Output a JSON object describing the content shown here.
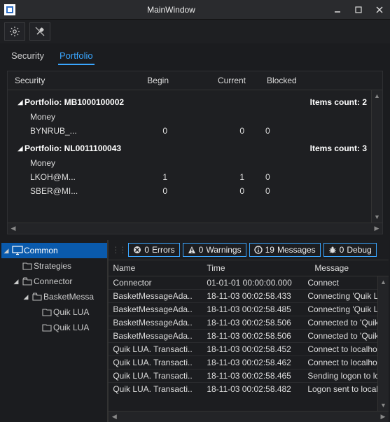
{
  "window": {
    "title": "MainWindow"
  },
  "tabs": {
    "security": "Security",
    "portfolio": "Portfolio",
    "active": "portfolio"
  },
  "grid": {
    "headers": {
      "security": "Security",
      "begin": "Begin",
      "current": "Current",
      "blocked": "Blocked"
    },
    "portfolio_label": "Portfolio:",
    "items_count_label": "Items count:",
    "groups": [
      {
        "id": "MB1000100002",
        "count": 2,
        "rows": [
          {
            "sec": "Money",
            "begin": "",
            "current": "",
            "blocked": ""
          },
          {
            "sec": "BYNRUB_...",
            "begin": "0",
            "current": "0",
            "blocked": "0"
          }
        ]
      },
      {
        "id": "NL0011100043",
        "count": 3,
        "rows": [
          {
            "sec": "Money",
            "begin": "",
            "current": "",
            "blocked": ""
          },
          {
            "sec": "LKOH@M...",
            "begin": "1",
            "current": "1",
            "blocked": "0"
          },
          {
            "sec": "SBER@MI...",
            "begin": "0",
            "current": "0",
            "blocked": "0"
          }
        ]
      }
    ]
  },
  "tree": {
    "items": [
      {
        "label": "Common",
        "icon": "monitor",
        "indent": 0,
        "expandable": true,
        "selected": true
      },
      {
        "label": "Strategies",
        "icon": "folder",
        "indent": 1,
        "expandable": false
      },
      {
        "label": "Connector",
        "icon": "folder-open",
        "indent": 1,
        "expandable": true
      },
      {
        "label": "BasketMessa",
        "icon": "folder-open",
        "indent": 2,
        "expandable": true
      },
      {
        "label": "Quik LUA",
        "icon": "folder",
        "indent": 3,
        "expandable": false
      },
      {
        "label": "Quik LUA",
        "icon": "folder",
        "indent": 3,
        "expandable": false
      }
    ]
  },
  "filters": {
    "errors": {
      "count": 0,
      "label": "Errors"
    },
    "warnings": {
      "count": 0,
      "label": "Warnings"
    },
    "messages": {
      "count": 19,
      "label": "Messages"
    },
    "debug": {
      "count": 0,
      "label": "Debug"
    }
  },
  "log": {
    "headers": {
      "name": "Name",
      "time": "Time",
      "message": "Message"
    },
    "rows": [
      {
        "name": "Connector",
        "time": "01-01-01 00:00:00.000",
        "msg": "Connect"
      },
      {
        "name": "BasketMessageAda..",
        "time": "18-11-03 00:02:58.433",
        "msg": "Connecting 'Quik LU"
      },
      {
        "name": "BasketMessageAda..",
        "time": "18-11-03 00:02:58.485",
        "msg": "Connecting 'Quik LU"
      },
      {
        "name": "BasketMessageAda..",
        "time": "18-11-03 00:02:58.506",
        "msg": "Connected to 'Quik l"
      },
      {
        "name": "BasketMessageAda..",
        "time": "18-11-03 00:02:58.506",
        "msg": "Connected to 'Quik l"
      },
      {
        "name": "Quik LUA. Transacti..",
        "time": "18-11-03 00:02:58.452",
        "msg": "Connect to localhost"
      },
      {
        "name": "Quik LUA. Transacti..",
        "time": "18-11-03 00:02:58.462",
        "msg": "Connect to localhost"
      },
      {
        "name": "Quik LUA. Transacti..",
        "time": "18-11-03 00:02:58.465",
        "msg": "Sending logon to loc"
      },
      {
        "name": "Quik LUA. Transacti..",
        "time": "18-11-03 00:02:58.482",
        "msg": "Logon sent to localh"
      }
    ]
  }
}
